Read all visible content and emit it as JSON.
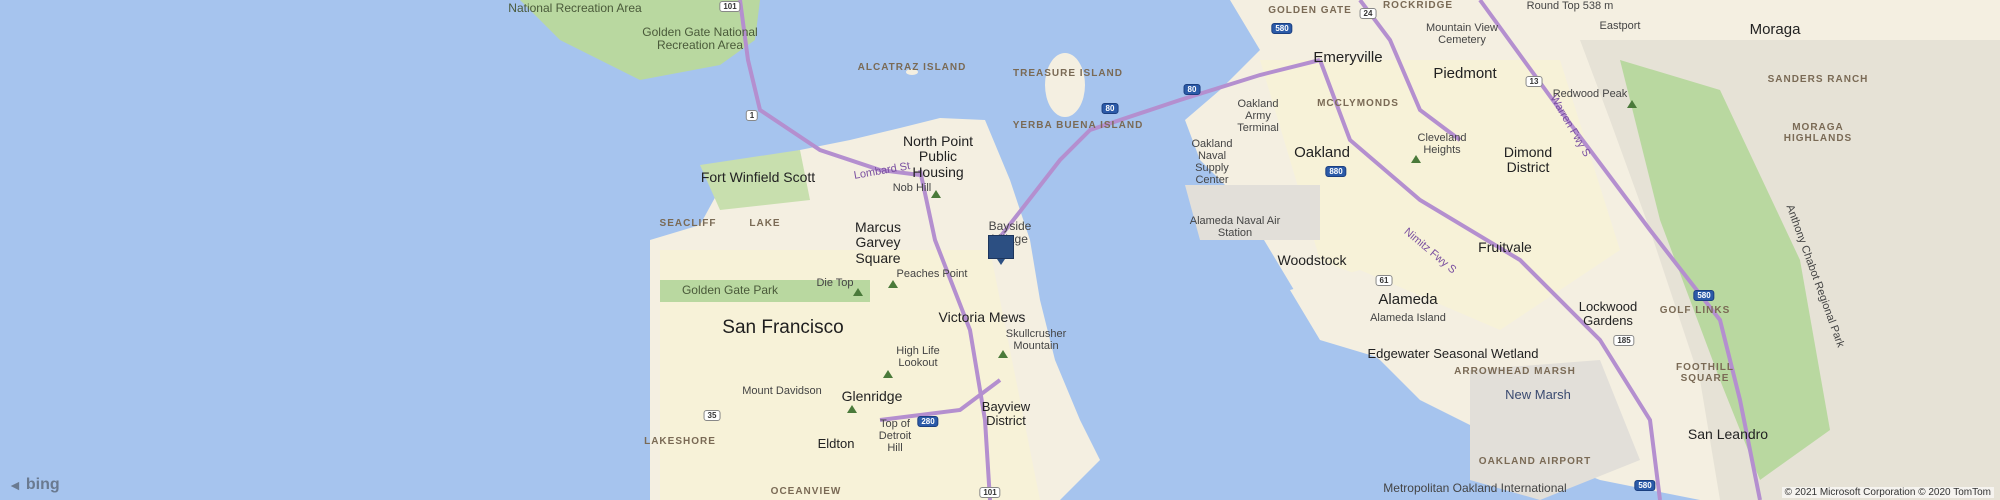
{
  "map": {
    "provider": "bing",
    "copyright": "© 2021 Microsoft Corporation © 2020 TomTom",
    "colors": {
      "water": "#a6c4ee",
      "land": "#f4efe1",
      "park": "#b9d8a0",
      "urban": "#f7f2d8",
      "highway": "#b48fcf",
      "pin": "#2c4f82"
    },
    "labels": {
      "national_recreation_area": "National Recreation Area",
      "golden_gate_nra": "Golden Gate National Recreation Area",
      "alcatraz_island": "ALCATRAZ ISLAND",
      "treasure_island": "TREASURE ISLAND",
      "yerba_buena_island": "YERBA BUENA ISLAND",
      "golden_gate": "GOLDEN GATE",
      "rockridge": "ROCKRIDGE",
      "emeryville": "Emeryville",
      "mountain_view_cemetery": "Mountain View Cemetery",
      "piedmont": "Piedmont",
      "eastport": "Eastport",
      "moraga": "Moraga",
      "round_top": "Round Top 538 m",
      "redwood_peak": "Redwood Peak",
      "sanders_ranch": "SANDERS RANCH",
      "moraga_highlands": "MORAGA HIGHLANDS",
      "north_point": "North Point Public Housing",
      "lombard_st": "Lombard St",
      "nob_hill": "Nob Hill",
      "fort_winfield_scott": "Fort Winfield Scott",
      "oakland_army_terminal": "Oakland Army Terminal",
      "mcclymonds": "MCCLYMONDS",
      "oakland": "Oakland",
      "cleveland_heights": "Cleveland Heights",
      "dimond_district": "Dimond District",
      "oakland_naval_supply": "Oakland Naval Supply Center",
      "seacliff": "SEACLIFF",
      "lake": "LAKE",
      "marcus_garvey": "Marcus Garvey Square",
      "bayside_village": "Bayside Village",
      "alameda_naval_air": "Alameda Naval Air Station",
      "fruitvale": "Fruitvale",
      "woodstock": "Woodstock",
      "nimitz_fwy": "Nimitz Fwy S",
      "warren_fwy": "Warren Fwy S",
      "golden_gate_park": "Golden Gate Park",
      "die_top": "Die Top",
      "peaches_point": "Peaches Point",
      "alameda": "Alameda",
      "alameda_island": "Alameda Island",
      "lockwood_gardens": "Lockwood Gardens",
      "golf_links": "GOLF LINKS",
      "san_francisco": "San Francisco",
      "victoria_mews": "Victoria Mews",
      "skullcrusher_mountain": "Skullcrusher Mountain",
      "edgewater_wetland": "Edgewater Seasonal Wetland",
      "high_life_lookout": "High Life Lookout",
      "arrowhead_marsh": "ARROWHEAD MARSH",
      "foothill_square": "FOOTHILL SQUARE",
      "mount_davidson": "Mount Davidson",
      "glenridge": "Glenridge",
      "new_marsh": "New Marsh",
      "bayview_district": "Bayview District",
      "top_of_detroit_hill": "Top of Detroit Hill",
      "lakeshore": "LAKESHORE",
      "eldton": "Eldton",
      "san_leandro": "San Leandro",
      "oakland_airport": "OAKLAND AIRPORT",
      "oceanview": "OCEANVIEW",
      "metropolitan_oakland": "Metropolitan Oakland International",
      "anthony_chabot": "Anthony Chabot Regional Park"
    },
    "shields": [
      "101",
      "1",
      "80",
      "80",
      "580",
      "24",
      "13",
      "880",
      "61",
      "580",
      "185",
      "35",
      "280",
      "101",
      "580"
    ]
  }
}
